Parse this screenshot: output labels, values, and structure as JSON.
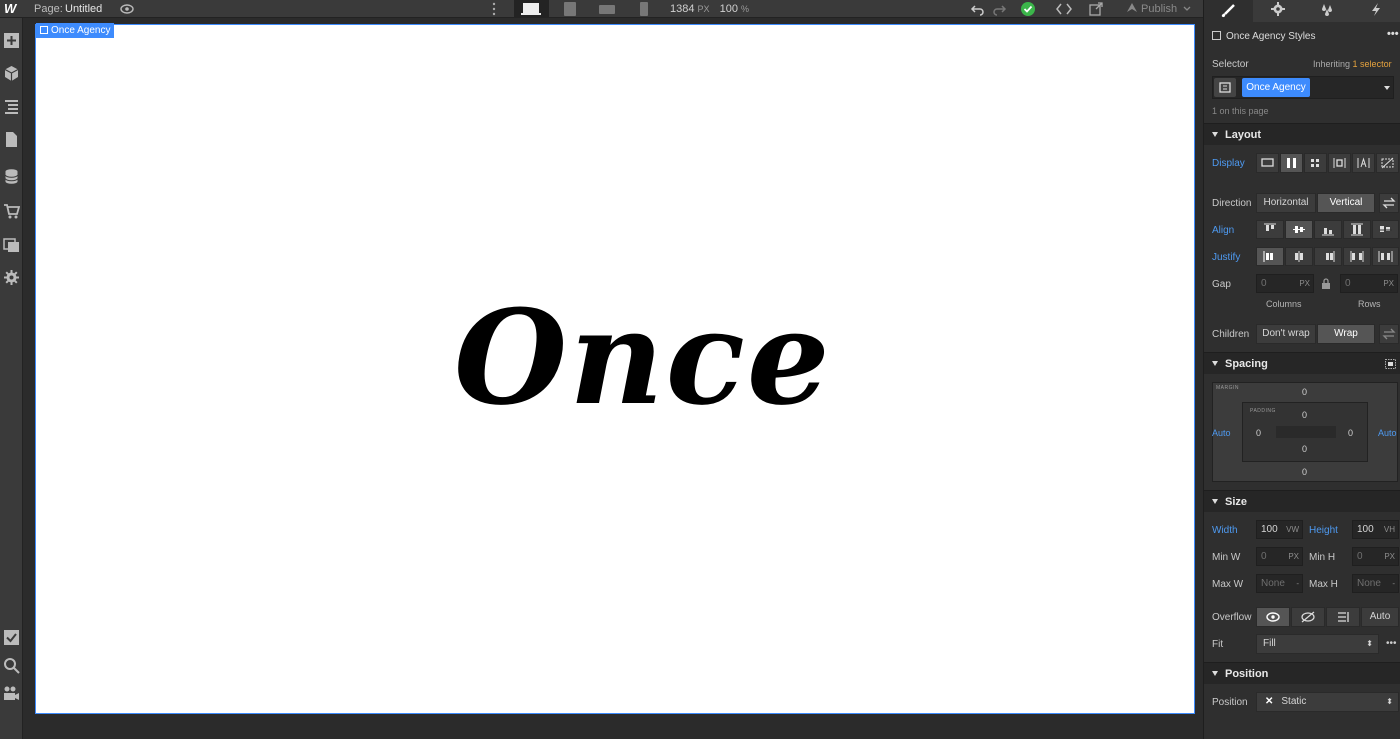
{
  "topbar": {
    "logo": "W",
    "page_label": "Page:",
    "page_name": "Untitled",
    "width_value": "1384",
    "width_unit": "PX",
    "zoom": "100",
    "zoom_unit": "%",
    "publish": "Publish"
  },
  "canvas": {
    "selected_tag": "Once Agency",
    "hero_text": "Once"
  },
  "panel": {
    "style_title": "Once Agency Styles",
    "selector_label": "Selector",
    "inheriting_prefix": "Inheriting",
    "inheriting_count": "1 selector",
    "selector_chip": "Once Agency",
    "on_page": "1 on this page",
    "layout": {
      "title": "Layout",
      "display_label": "Display",
      "direction_label": "Direction",
      "direction_options": [
        "Horizontal",
        "Vertical"
      ],
      "align_label": "Align",
      "justify_label": "Justify",
      "gap_label": "Gap",
      "gap_columns_value": "0",
      "gap_rows_value": "0",
      "gap_unit": "PX",
      "gap_columns_label": "Columns",
      "gap_rows_label": "Rows",
      "children_label": "Children",
      "children_options": [
        "Don't wrap",
        "Wrap"
      ]
    },
    "spacing": {
      "title": "Spacing",
      "margin_label": "MARGIN",
      "padding_label": "PADDING",
      "margin_top": "0",
      "margin_bottom": "0",
      "margin_left": "Auto",
      "margin_right": "Auto",
      "padding_top": "0",
      "padding_bottom": "0",
      "padding_left": "0",
      "padding_right": "0"
    },
    "size": {
      "title": "Size",
      "width_label": "Width",
      "width_value": "100",
      "width_unit": "VW",
      "height_label": "Height",
      "height_value": "100",
      "height_unit": "VH",
      "min_w_label": "Min W",
      "min_w_value": "0",
      "min_w_unit": "PX",
      "min_h_label": "Min H",
      "min_h_value": "0",
      "min_h_unit": "PX",
      "max_w_label": "Max W",
      "max_w_value": "None",
      "max_w_unit": "-",
      "max_h_label": "Max H",
      "max_h_value": "None",
      "max_h_unit": "-",
      "overflow_label": "Overflow",
      "overflow_auto": "Auto",
      "fit_label": "Fit",
      "fit_value": "Fill"
    },
    "position": {
      "title": "Position",
      "label": "Position",
      "value": "Static"
    }
  }
}
